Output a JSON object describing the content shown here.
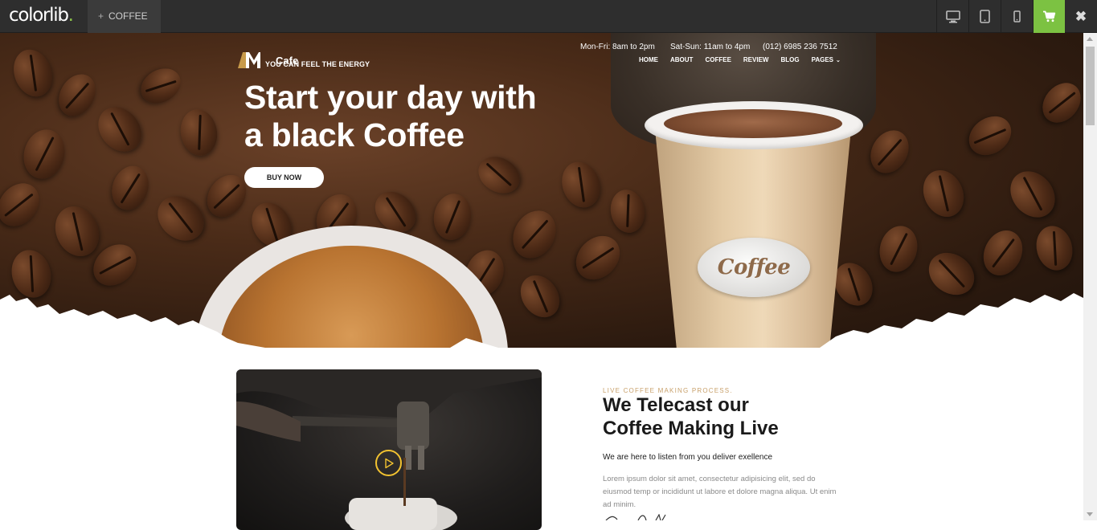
{
  "demo_bar": {
    "brand": "colorlib",
    "brand_dot": ".",
    "tab_plus": "+",
    "tab_label": "COFFEE",
    "devices": [
      "desktop-icon",
      "tablet-icon",
      "mobile-icon"
    ],
    "cart_icon": "cart-icon",
    "close_icon": "close-icon",
    "close_glyph": "✖",
    "accent": "#7cc242"
  },
  "hero": {
    "logo_text": "Cafe",
    "tagline": "YOU CAN FEEL THE ENERGY",
    "hours_weekdays": "Mon-Fri: 8am to 2pm",
    "hours_weekend": "Sat-Sun: 11am to 4pm",
    "phone": "(012) 6985 236 7512",
    "nav": [
      "HOME",
      "ABOUT",
      "COFFEE",
      "REVIEW",
      "BLOG",
      "PAGES"
    ],
    "title_line1": "Start your day with",
    "title_line2": "a black Coffee",
    "cta": "BUY NOW",
    "cup_label": "Coffee"
  },
  "live": {
    "subtitle": "LIVE COFFEE MAKING PROCESS.",
    "title_line1": "We Telecast our",
    "title_line2": "Coffee Making Live",
    "lead": "We are here to listen from you deliver exellence",
    "body": "Lorem ipsum dolor sit amet, consectetur adipisicing elit, sed do eiusmod temp or incididunt ut labore et dolore magna aliqua. Ut enim ad minim.",
    "play_icon": "play-icon",
    "accent": "#f2c230"
  }
}
